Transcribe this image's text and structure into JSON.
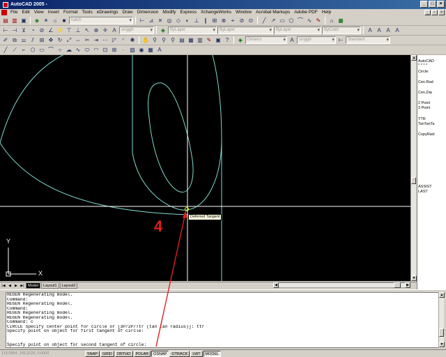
{
  "window": {
    "title": "AutoCAD 2005 -"
  },
  "menu": [
    "File",
    "Edit",
    "View",
    "Insert",
    "Format",
    "Tools",
    "eDrawings",
    "Draw",
    "Dimension",
    "Modify",
    "Express",
    "XchangeWorks",
    "Window",
    "Acrobat Markups",
    "Adobe PDF",
    "Help"
  ],
  "toolbar": {
    "style_combo": "hatch",
    "text_style_combo": "singgh",
    "layer_combo": "ByLayer",
    "linetype_combo": "ByLayer",
    "lineweight_combo": "ByLayer",
    "color_combo": "ByColor",
    "layer_name_combo": "Dimens",
    "text_style2_combo": "singgh",
    "dim_style_combo": "Standard"
  },
  "side_menu": {
    "items": [
      "AutoCAD",
      "* * * *",
      "Circle:",
      "Cen,Rad",
      "Cen,Dia",
      "2 Point",
      "3 Point",
      "TTR",
      "TanTanTa",
      "CopyRad:",
      "ASSIST",
      "LAST"
    ]
  },
  "drawing": {
    "tooltip": "Deferred Tangent",
    "ucs_x": "X",
    "ucs_y": "Y",
    "annotation_number": "4"
  },
  "tabs": [
    "Model",
    "Layout1",
    "Layout2"
  ],
  "command_history": [
    "REGEN Regenerating model.",
    "Command:",
    "REGEN Regenerating model.",
    "Command:",
    "REGEN Regenerating model.",
    "REGEN Regenerating model.",
    "Command: c",
    "CIRCLE Specify center point for circle or [3P/2P/Ttr (tan tan radius)]: ttr",
    "Specify point on object for first tangent of circle:"
  ],
  "command_prompt": "Specify point on object for second tangent of circle:",
  "status": {
    "coords": "119.5894, 145.3126, 0.0000",
    "buttons": [
      "SNAP",
      "GRID",
      "ORTHO",
      "POLAR",
      "OSNAP",
      "OTRACK",
      "LWT",
      "MODEL"
    ],
    "active": [
      "OSNAP",
      "MODEL"
    ]
  },
  "colors": {
    "drawing_bg": "#000000",
    "geometry": "#7fdcd0",
    "crosshair": "#ffffff",
    "annotation": "#e02020"
  }
}
